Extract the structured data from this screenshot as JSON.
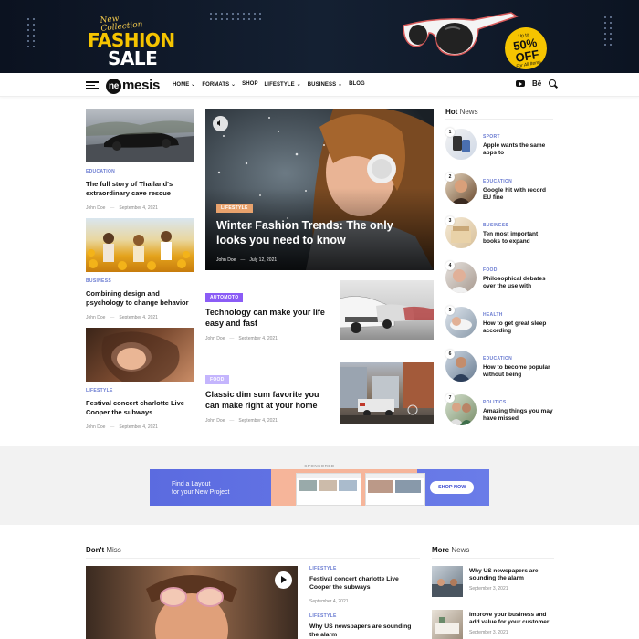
{
  "banner": {
    "small_text": "New Collection",
    "headline_line1": "FASHION",
    "headline_line2": "SALE",
    "badge_pre": "Up to",
    "badge_discount": "50% OFF",
    "badge_post": "For All Items"
  },
  "nav": {
    "logo_mark": "ne",
    "logo_text": "mesis",
    "items": [
      "HOME",
      "FORMATS",
      "SHOP",
      "LIFESTYLE",
      "BUSINESS",
      "BLOG"
    ],
    "dropdown_flags": [
      true,
      true,
      false,
      true,
      true,
      false
    ],
    "icons": [
      "youtube-icon",
      "behance-icon",
      "search-icon"
    ],
    "behance_label": "Bē"
  },
  "left_posts": [
    {
      "category": "EDUCATION",
      "title": "The full story of Thailand's extraordinary cave rescue",
      "author": "John Doe",
      "date": "September 4, 2021"
    },
    {
      "category": "BUSINESS",
      "title": "Combining design and psychology to change behavior",
      "author": "John Doe",
      "date": "September 4, 2021"
    },
    {
      "category": "LIFESTYLE",
      "title": "Festival concert charlotte Live Cooper the subways",
      "author": "John Doe",
      "date": "September 4, 2021"
    }
  ],
  "hero": {
    "tag": "LIFESTYLE",
    "title": "Winter Fashion Trends: The only looks you need to know",
    "author": "John Doe",
    "date": "July 12, 2021"
  },
  "mid_posts": [
    {
      "tag": "AUTOMOTO",
      "tag_color": "#8b5cf6",
      "title": "Technology can make your life easy and fast",
      "author": "John Doe",
      "date": "September 4, 2021"
    },
    {
      "tag": "FOOD",
      "tag_color": "#c4b5fd",
      "title": "Classic dim sum favorite you can make right at your home",
      "author": "John Doe",
      "date": "September 4, 2021"
    }
  ],
  "hot_news": {
    "heading_bold": "Hot",
    "heading_rest": "News",
    "items": [
      {
        "num": "1",
        "category": "SPORT",
        "title": "Apple wants the same apps to"
      },
      {
        "num": "2",
        "category": "EDUCATION",
        "title": "Google hit with record EU fine"
      },
      {
        "num": "3",
        "category": "BUSINESS",
        "title": "Ten most important books to expand"
      },
      {
        "num": "4",
        "category": "FOOD",
        "title": "Philosophical debates over the use with"
      },
      {
        "num": "5",
        "category": "HEALTH",
        "title": "How to get great sleep according"
      },
      {
        "num": "6",
        "category": "EDUCATION",
        "title": "How to become popular without being"
      },
      {
        "num": "7",
        "category": "POLITICS",
        "title": "Amazing things you may have missed"
      }
    ]
  },
  "sponsored": {
    "label": "- SPONSORED -",
    "ad_line1": "Find a Layout",
    "ad_line2": "for your New Project",
    "cta": "SHOP NOW"
  },
  "dont_miss": {
    "heading_bold": "Don't",
    "heading_rest": "Miss",
    "posts": [
      {
        "category": "LIFESTYLE",
        "title": "Festival concert charlotte Live Cooper the subways",
        "date": "September 4, 2021"
      },
      {
        "category": "LIFESTYLE",
        "title": "Why US newspapers are sounding the alarm",
        "date": ""
      }
    ]
  },
  "more_news": {
    "heading_bold": "More",
    "heading_rest": "News",
    "posts": [
      {
        "title": "Why US newspapers are sounding the alarm",
        "date": "September 3, 2021"
      },
      {
        "title": "Improve your business and add value for your customer",
        "date": "September 3, 2021"
      }
    ]
  }
}
